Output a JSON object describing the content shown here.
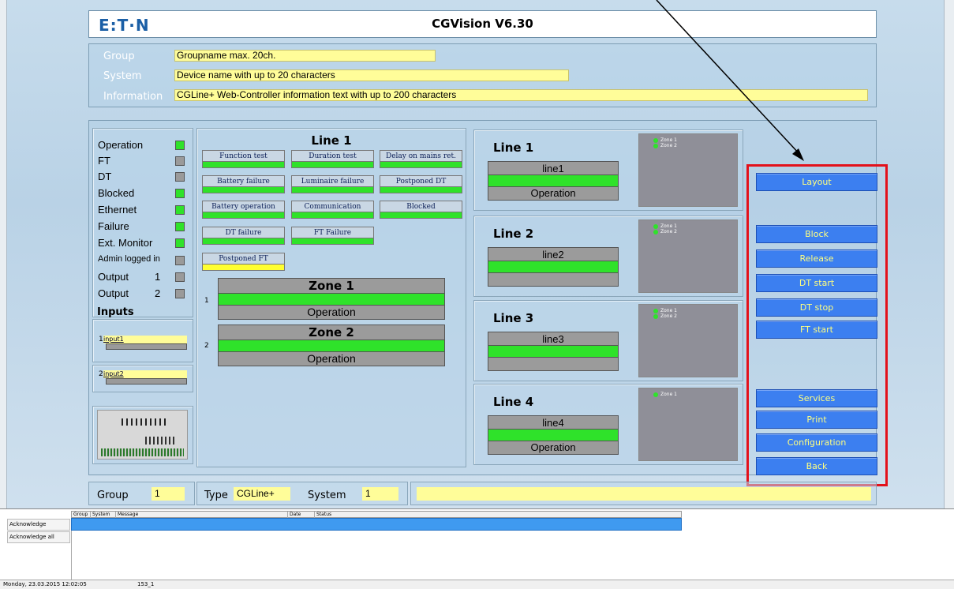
{
  "app": {
    "logo": "E:T·N",
    "title": "CGVision V6.30"
  },
  "info": {
    "group_label": "Group",
    "group_value": "Groupname max. 20ch.",
    "system_label": "System",
    "system_value": "Device name with up to 20 characters",
    "info_label": "Information",
    "info_value": "CGLine+ Web-Controller information text with up to 200 characters"
  },
  "status": {
    "items": [
      {
        "label": "Operation",
        "state": "green"
      },
      {
        "label": "FT",
        "state": "gray"
      },
      {
        "label": "DT",
        "state": "gray"
      },
      {
        "label": "Blocked",
        "state": "green"
      },
      {
        "label": "Ethernet",
        "state": "green"
      },
      {
        "label": "Failure",
        "state": "green"
      },
      {
        "label": "Ext. Monitor",
        "state": "green"
      },
      {
        "label": "Admin logged in",
        "state": "gray"
      },
      {
        "label": "Output",
        "num": "1",
        "state": "gray"
      },
      {
        "label": "Output",
        "num": "2",
        "state": "gray"
      }
    ],
    "inputs_title": "Inputs",
    "inputs": [
      {
        "num": "1",
        "name": "input1"
      },
      {
        "num": "2",
        "name": "input2"
      }
    ]
  },
  "line_detail": {
    "title": "Line 1",
    "buttons": [
      {
        "label": "Function test",
        "bar": "green"
      },
      {
        "label": "Duration test",
        "bar": "green"
      },
      {
        "label": "Delay on mains ret.",
        "bar": "green"
      },
      {
        "label": "Battery failure",
        "bar": "green"
      },
      {
        "label": "Luminaire failure",
        "bar": "green"
      },
      {
        "label": "Postponed DT",
        "bar": "green"
      },
      {
        "label": "Battery operation",
        "bar": "green"
      },
      {
        "label": "Communication",
        "bar": "green"
      },
      {
        "label": "Blocked",
        "bar": "green"
      },
      {
        "label": "DT failure",
        "bar": "green"
      },
      {
        "label": "FT Failure",
        "bar": "green"
      },
      {
        "label": "Postponed FT",
        "bar": "yellow"
      }
    ],
    "zones": [
      {
        "num": "1",
        "name": "Zone 1",
        "status": "Operation"
      },
      {
        "num": "2",
        "name": "Zone 2",
        "status": "Operation"
      }
    ]
  },
  "lines": [
    {
      "title": "Line 1",
      "name": "line1",
      "status": "Operation",
      "zones": [
        "Zone 1",
        "Zone 2"
      ]
    },
    {
      "title": "Line 2",
      "name": "line2",
      "status": "",
      "zones": [
        "Zone 1",
        "Zone 2"
      ]
    },
    {
      "title": "Line 3",
      "name": "line3",
      "status": "",
      "zones": [
        "Zone 1",
        "Zone 2"
      ]
    },
    {
      "title": "Line 4",
      "name": "line4",
      "status": "Operation",
      "zones": [
        "Zone 1"
      ]
    }
  ],
  "actions": {
    "layout": "Layout",
    "block": "Block",
    "release": "Release",
    "dt_start": "DT start",
    "dt_stop": "DT stop",
    "ft_start": "FT start",
    "services": "Services",
    "print": "Print",
    "configuration": "Configuration",
    "back": "Back"
  },
  "bottom": {
    "group_label": "Group",
    "group_value": "1",
    "type_label": "Type",
    "type_value": "CGLine+",
    "system_label": "System",
    "system_value": "1",
    "message_value": ""
  },
  "messages": {
    "acknowledge": "Acknowledge",
    "acknowledge_all": "Acknowledge all",
    "columns": [
      "Group",
      "System",
      "Message",
      "Date",
      "Status"
    ]
  },
  "statusbar": {
    "datetime": "Monday, 23.03.2015 12:02:05",
    "code": "153_1"
  },
  "colors": {
    "highlight": "#e3111b",
    "button_blue": "#3c7ff0",
    "ok_green": "#2fe22a",
    "field_yellow": "#fffd99"
  }
}
